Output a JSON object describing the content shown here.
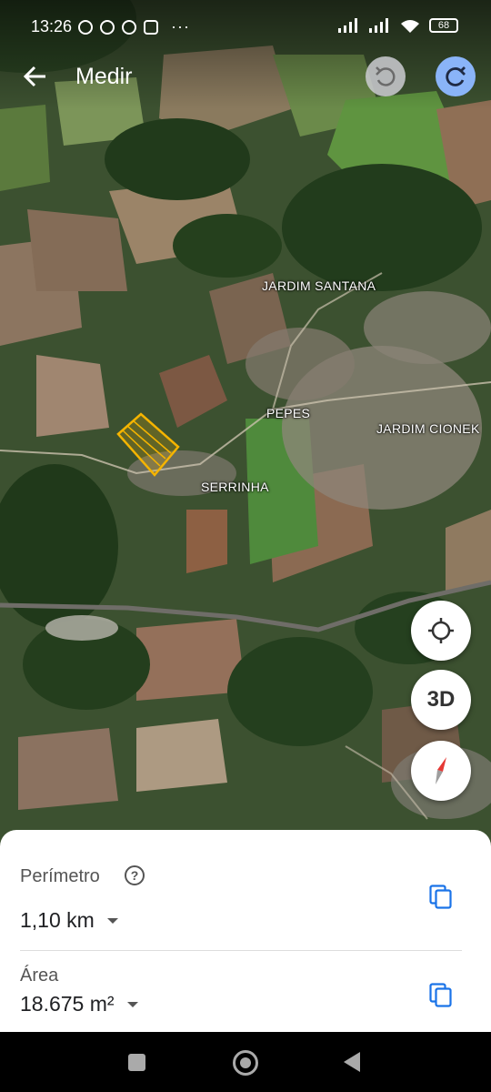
{
  "status_bar": {
    "time": "13:26",
    "battery": "68",
    "more": "···",
    "left_icons": [
      "alarm-icon",
      "chat-icon",
      "messenger-icon",
      "instagram-icon"
    ],
    "right_icons": [
      "signal-icon",
      "signal-icon",
      "wifi-icon",
      "battery-icon"
    ]
  },
  "app_bar": {
    "title": "Medir",
    "back_icon": "arrow-left-icon",
    "undo_icon": "undo-icon",
    "redo_icon": "redo-icon"
  },
  "map": {
    "places": [
      "JARDIM SANTANA",
      "PEPES",
      "JARDIM CIONEK",
      "SERRINHA"
    ],
    "measure_color": "#f5b400"
  },
  "fabs": {
    "location_icon": "my-location-icon",
    "three_d_label": "3D",
    "compass_icon": "compass-icon"
  },
  "measurement": {
    "perimeter_label": "Perímetro",
    "perimeter_value": "1,10 km",
    "area_label": "Área",
    "area_value": "18.675 m²",
    "help_glyph": "?"
  },
  "colors": {
    "accent": "#1a73e8",
    "redo_bg": "#8ab4f8"
  }
}
